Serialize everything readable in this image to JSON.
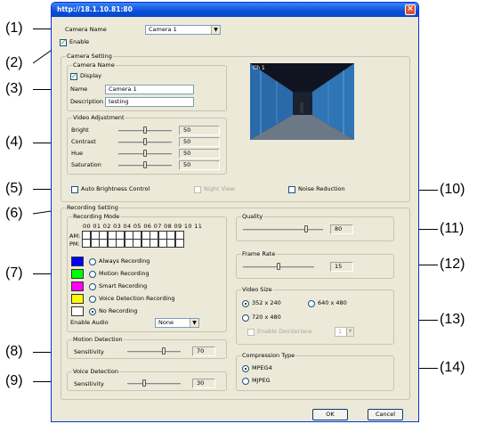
{
  "title": "http://18.1.10.81:80",
  "callouts": [
    "(1)",
    "(2)",
    "(3)",
    "(4)",
    "(5)",
    "(6)",
    "(7)",
    "(8)",
    "(9)",
    "(10)",
    "(11)",
    "(12)",
    "(13)",
    "(14)"
  ],
  "camera_name_label": "Camera Name",
  "camera_select": "Camera 1",
  "enable_label": "Enable",
  "camera_setting": {
    "group": "Camera Setting",
    "name_group": "Camera Name",
    "display_label": "Display",
    "name_label": "Name",
    "name_value": "Camera 1",
    "desc_label": "Description",
    "desc_value": "testing",
    "overlay": "Ch 1"
  },
  "video_adjustment": {
    "group": "Video Adjustment",
    "rows": [
      {
        "label": "Bright",
        "value": "50",
        "level": 0.5
      },
      {
        "label": "Contrast",
        "value": "50",
        "level": 0.5
      },
      {
        "label": "Hue",
        "value": "50",
        "level": 0.5
      },
      {
        "label": "Saturation",
        "value": "50",
        "level": 0.5
      }
    ]
  },
  "auto_brightness": "Auto Brightness Control",
  "night_view": "Night View",
  "noise_reduction": "Noise Reduction",
  "recording": {
    "group": "Recording Setting",
    "mode_group": "Recording Mode",
    "hours": "00 01 02 03 04 05 06 07 08 09 10 11",
    "am": "AM:",
    "pm": "PM:",
    "modes": [
      {
        "label": "Always Recording",
        "color": "#0000ff"
      },
      {
        "label": "Motion Recording",
        "color": "#00ff00"
      },
      {
        "label": "Smart Recording",
        "color": "#ff00ff"
      },
      {
        "label": "Voice Detection Recording",
        "color": "#ffff00"
      },
      {
        "label": "No Recording",
        "color": "#ffffff"
      }
    ],
    "enable_audio_label": "Enable Audio",
    "enable_audio_value": "None"
  },
  "motion": {
    "group": "Motion Detection",
    "label": "Sensitivity",
    "value": "70",
    "level": 0.7
  },
  "voice": {
    "group": "Voice Detection",
    "label": "Sensitivity",
    "value": "30",
    "level": 0.3
  },
  "quality": {
    "group": "Quality",
    "value": "80",
    "level": 0.8
  },
  "frame_rate": {
    "group": "Frame Rate",
    "value": "15",
    "level": 0.5
  },
  "video_size": {
    "group": "Video Size",
    "options": [
      "352 x 240",
      "640 x 480",
      "720 x 480"
    ],
    "deinterlace": "Enable Deinterlace",
    "deint_value": "1"
  },
  "compression": {
    "group": "Compression Type",
    "options": [
      "MPEG4",
      "MJPEG"
    ]
  },
  "ok": "OK",
  "cancel": "Cancel"
}
